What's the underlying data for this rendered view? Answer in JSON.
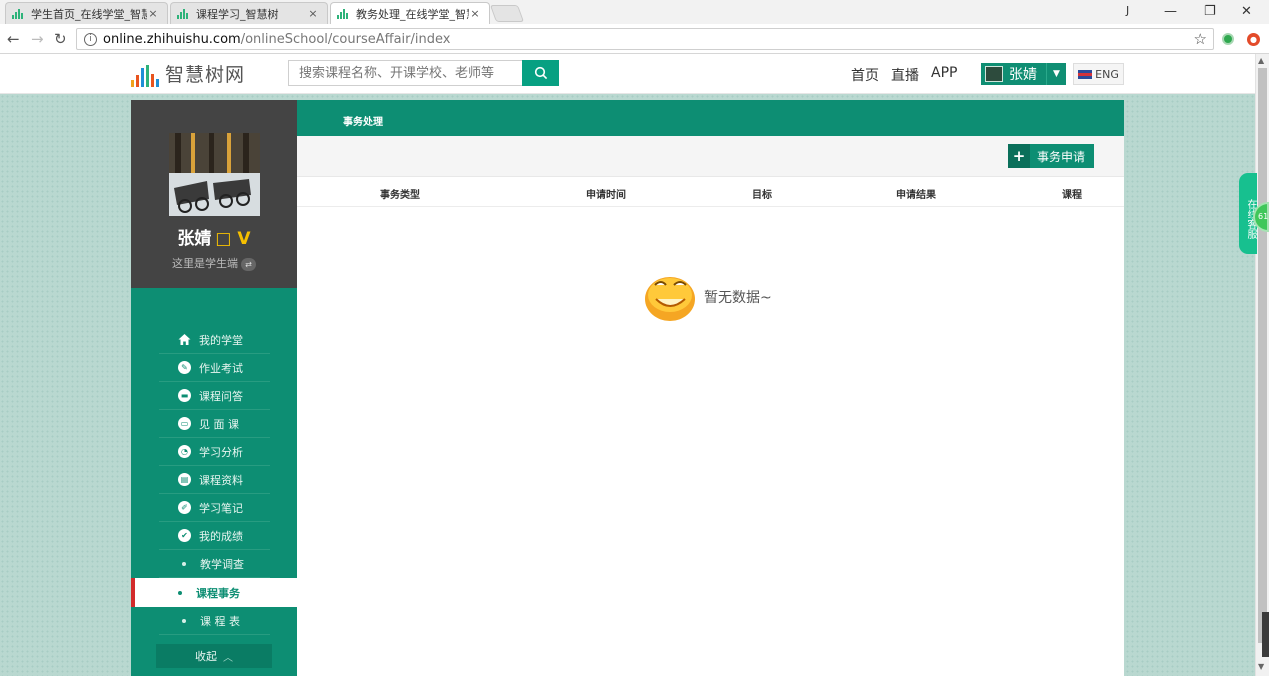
{
  "browser": {
    "tabs": [
      {
        "title": "学生首页_在线学堂_智慧",
        "close": "×"
      },
      {
        "title": "课程学习_智慧树",
        "close": "×"
      },
      {
        "title": "教务处理_在线学堂_智慧",
        "close": "×"
      }
    ],
    "window_controls": {
      "user": "J",
      "minimize": "—",
      "restore": "❐",
      "close": "✕"
    },
    "url_host": "online.zhihuishu.com",
    "url_path": "/onlineSchool/courseAffair/index",
    "icons": [
      "back-icon",
      "forward-icon",
      "reload-icon",
      "info-icon",
      "star-icon",
      "extension-green-icon",
      "extension-red-icon"
    ]
  },
  "header": {
    "logo_text": "智慧树网",
    "search_placeholder": "搜索课程名称、开课学校、老师等",
    "nav": {
      "home": "首页",
      "live": "直播",
      "app": "APP"
    },
    "user_name": "张婧",
    "lang_label": "ENG",
    "colors": {
      "brand": "#07a082",
      "logo_bars": [
        "#f0a21b",
        "#e8541e",
        "#1e8fd6",
        "#2db37a"
      ]
    }
  },
  "sidebar": {
    "profile": {
      "name": "张婧",
      "vip_mark": "□ V",
      "role_text": "这里是学生端"
    },
    "items": [
      {
        "label": "我的学堂",
        "icon": "home-icon"
      },
      {
        "label": "作业考试",
        "icon": "pencil-icon"
      },
      {
        "label": "课程问答",
        "icon": "chat-icon"
      },
      {
        "label": "见 面 课",
        "icon": "meeting-icon"
      },
      {
        "label": "学习分析",
        "icon": "analysis-icon"
      },
      {
        "label": "课程资料",
        "icon": "materials-icon"
      },
      {
        "label": "学习笔记",
        "icon": "notes-icon"
      },
      {
        "label": "我的成绩",
        "icon": "check-icon"
      },
      {
        "label": "教学调查",
        "icon": "dot-icon"
      },
      {
        "label": "课程事务",
        "icon": "dot-icon",
        "active": true
      },
      {
        "label": "课 程 表",
        "icon": "dot-icon"
      }
    ],
    "collapse_label": "收起",
    "collapse_icon": "chevron-up-icon"
  },
  "main": {
    "section_title": "事务处理",
    "apply_button": "事务申请",
    "columns": [
      "事务类型",
      "申请时间",
      "目标",
      "申请结果",
      "课程"
    ],
    "empty_text": "暂无数据~"
  },
  "float_service": {
    "label": "在线客服",
    "badge": "61"
  }
}
